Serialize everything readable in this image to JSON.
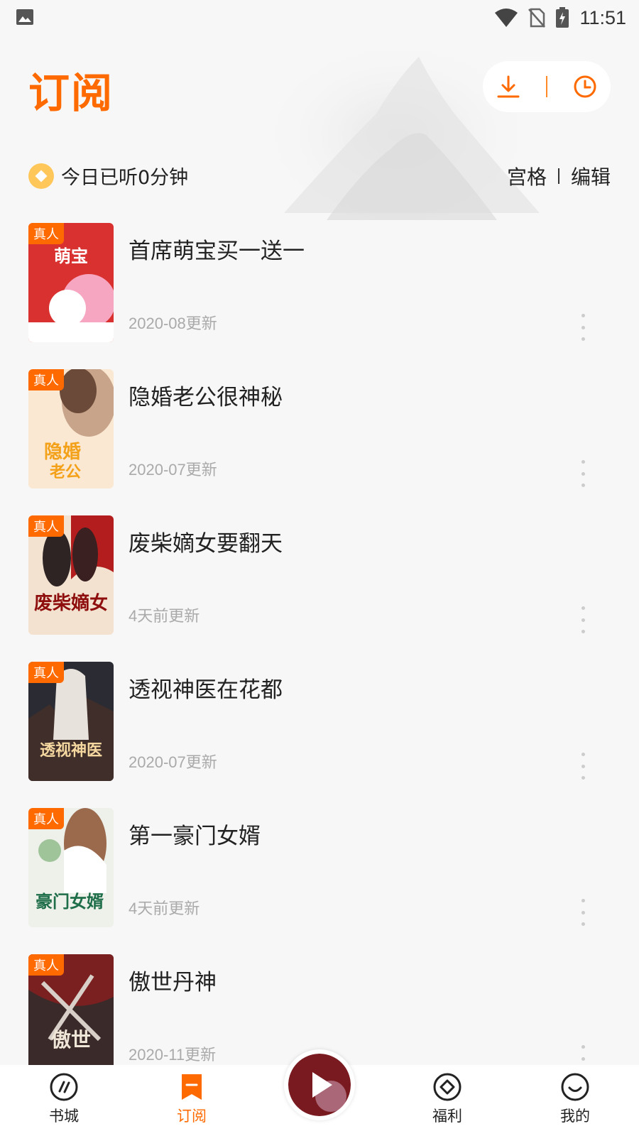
{
  "status_bar": {
    "time": "11:51",
    "icons": [
      "image-icon",
      "wifi-icon",
      "no-sim-icon",
      "battery-charging-icon"
    ]
  },
  "header": {
    "title": "订阅",
    "actions": [
      "download-icon",
      "history-clock-icon"
    ],
    "accent_color": "#ff6a00"
  },
  "listen": {
    "text": "今日已听0分钟"
  },
  "view_toggle": {
    "grid_label": "宫格",
    "edit_label": "编辑"
  },
  "books": [
    {
      "title": "首席萌宝买一送一",
      "tag": "真人",
      "update": "2020-08更新"
    },
    {
      "title": "隐婚老公很神秘",
      "tag": "真人",
      "update": "2020-07更新"
    },
    {
      "title": "废柴嫡女要翻天",
      "tag": "真人",
      "update": "4天前更新"
    },
    {
      "title": "透视神医在花都",
      "tag": "真人",
      "update": "2020-07更新"
    },
    {
      "title": "第一豪门女婿",
      "tag": "真人",
      "update": "4天前更新"
    },
    {
      "title": "傲世丹神",
      "tag": "真人",
      "update": "2020-11更新"
    }
  ],
  "bottom_nav": {
    "items": [
      {
        "label": "书城",
        "icon": "bookstore-icon"
      },
      {
        "label": "订阅",
        "icon": "bookmark-icon",
        "active": true
      },
      {
        "label": "福利",
        "icon": "welfare-icon"
      },
      {
        "label": "我的",
        "icon": "smile-icon"
      }
    ],
    "player_icon": "play-icon"
  }
}
